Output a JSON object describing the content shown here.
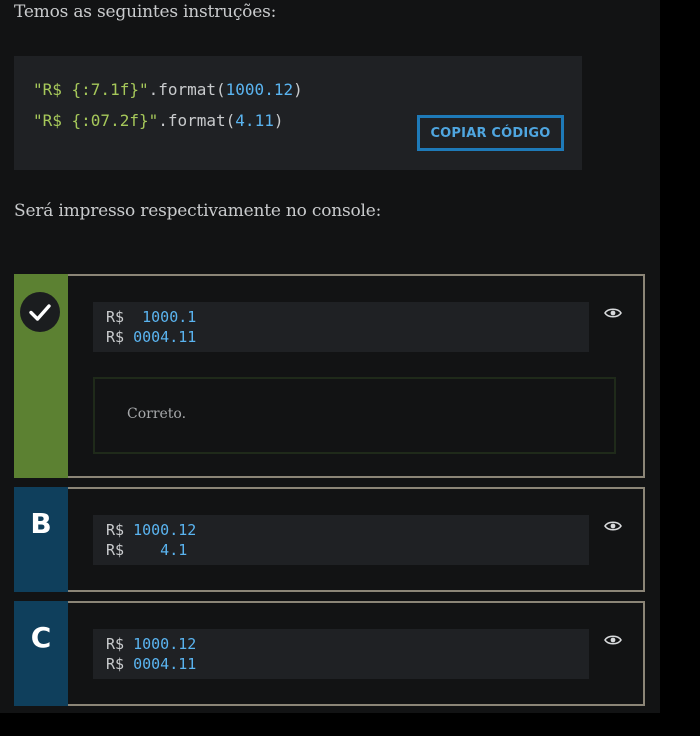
{
  "intro_text": "Temos as seguintes instruções:",
  "code": {
    "line1": {
      "string": "\"R$ {:7.1f}\"",
      "method": ".format(",
      "arg": "1000.12",
      "close": ")"
    },
    "line2": {
      "string": "\"R$ {:07.2f}\"",
      "method": ".format(",
      "arg": "4.11",
      "close": ")"
    },
    "copy_button_label": "COPIAR CÓDIGO"
  },
  "question_text": "Será impresso respectivamente no console:",
  "options": [
    {
      "status": "correct",
      "lines": [
        {
          "prefix": "R$",
          "value": "  1000.1"
        },
        {
          "prefix": "R$",
          "value": " 0004.11"
        }
      ],
      "feedback": "Correto."
    },
    {
      "letter": "B",
      "lines": [
        {
          "prefix": "R$",
          "value": " 1000.12"
        },
        {
          "prefix": "R$",
          "value": "    4.1"
        }
      ]
    },
    {
      "letter": "C",
      "lines": [
        {
          "prefix": "R$",
          "value": " 1000.12"
        },
        {
          "prefix": "R$",
          "value": " 0004.11"
        }
      ]
    }
  ],
  "icons": {
    "correct": "check-icon",
    "reveal": "eye-icon"
  },
  "colors": {
    "string": "#a6c85a",
    "number": "#5ab4f0",
    "correct_bar": "#5c8132",
    "option_bar": "#0f3f5c",
    "copy_button": "#1e7ab8"
  }
}
